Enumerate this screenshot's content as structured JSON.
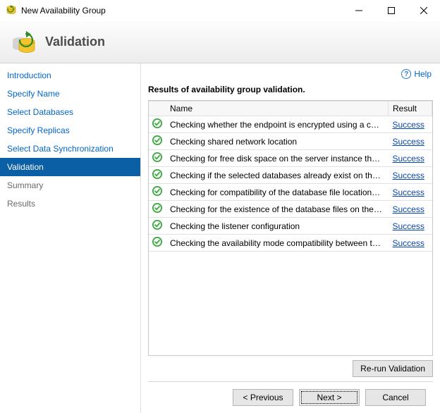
{
  "window": {
    "title": "New Availability Group",
    "min_tooltip": "Minimize",
    "max_tooltip": "Maximize",
    "close_tooltip": "Close"
  },
  "header": {
    "step_title": "Validation"
  },
  "help": {
    "label": "Help"
  },
  "sidebar": {
    "items": [
      {
        "label": "Introduction",
        "active": false,
        "muted": false
      },
      {
        "label": "Specify Name",
        "active": false,
        "muted": false
      },
      {
        "label": "Select Databases",
        "active": false,
        "muted": false
      },
      {
        "label": "Specify Replicas",
        "active": false,
        "muted": false
      },
      {
        "label": "Select Data Synchronization",
        "active": false,
        "muted": false
      },
      {
        "label": "Validation",
        "active": true,
        "muted": false
      },
      {
        "label": "Summary",
        "active": false,
        "muted": true
      },
      {
        "label": "Results",
        "active": false,
        "muted": true
      }
    ]
  },
  "main": {
    "results_header": "Results of availability group validation.",
    "columns": {
      "icon": "",
      "name": "Name",
      "result": "Result"
    },
    "rows": [
      {
        "name": "Checking whether the endpoint is encrypted using a compatible algorithm",
        "result": "Success"
      },
      {
        "name": "Checking shared network location",
        "result": "Success"
      },
      {
        "name": "Checking for free disk space on the server instance that hosts secondary re...",
        "result": "Success"
      },
      {
        "name": "Checking if the selected databases already exist on the server instance that ...",
        "result": "Success"
      },
      {
        "name": "Checking for compatibility of the database file locations on the server insta...",
        "result": "Success"
      },
      {
        "name": "Checking for the existence of the database files on the server instance that ...",
        "result": "Success"
      },
      {
        "name": "Checking the listener configuration",
        "result": "Success"
      },
      {
        "name": "Checking the availability mode compatibility between the primary and sec...",
        "result": "Success"
      }
    ],
    "rerun_label": "Re-run Validation"
  },
  "footer": {
    "previous": "< Previous",
    "next": "Next >",
    "cancel": "Cancel"
  }
}
